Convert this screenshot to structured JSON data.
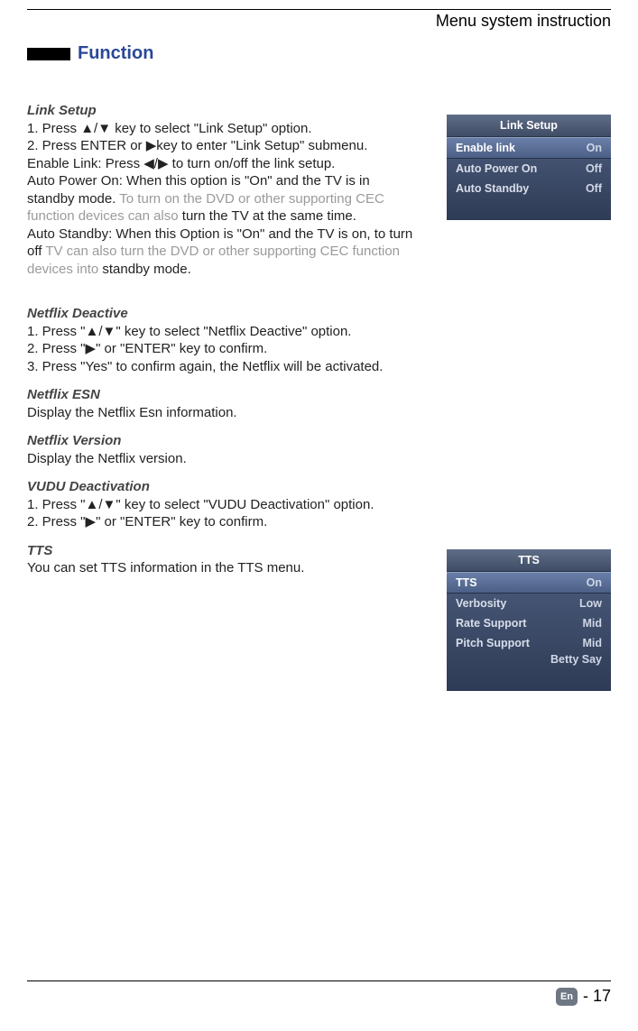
{
  "header": {
    "chapter": "Menu system instruction",
    "section": "Function"
  },
  "linkSetup": {
    "heading": "Link Setup",
    "l1a": "1. Press  ",
    "l1b": " key to select \"Link Setup\" option.",
    "l2a": "2. Press ENTER or ",
    "l2b": "key to enter \"Link Setup\" submenu.",
    "l3a": "Enable Link: Press  ",
    "l3b": "    to turn on/off the link setup.",
    "l4a": "Auto Power On: When this option is \"On\" and the TV is in standby mode. ",
    "l4_faded": "To turn on the DVD or other supporting CEC function devices can also ",
    "l4b": "turn the TV at the same time.",
    "l5a": "Auto Standby: When this Option is \"On\" and the TV is on, to turn off ",
    "l5_faded": "TV can also turn the DVD or other supporting CEC function devices into ",
    "l5b": "standby mode."
  },
  "netflixDeactive": {
    "heading": "Netflix Deactive",
    "l1a": "1. Press \"",
    "l1b": "\" key to select \"Netflix Deactive\" option.",
    "l2a": "2. Press \"",
    "l2b": "\" or \"ENTER\" key to confirm.",
    "l3": "3. Press \"Yes\" to confirm again, the Netflix will be activated."
  },
  "netflixEsn": {
    "heading": "Netflix ESN",
    "body": "Display the Netflix Esn information."
  },
  "netflixVersion": {
    "heading": "Netflix Version",
    "body": "Display the Netflix version."
  },
  "vudu": {
    "heading": "VUDU Deactivation",
    "l1a": "1. Press \"",
    "l1b": "\" key to select \"VUDU Deactivation\" option.",
    "l2a": "2. Press \"",
    "l2b": "\" or \"ENTER\" key to confirm."
  },
  "tts": {
    "heading": "TTS",
    "body": "You can set TTS information in the TTS menu."
  },
  "arrows": {
    "updown": "▲/▼",
    "right": "▶",
    "leftright": "◀/▶"
  },
  "osdLinkSetup": {
    "title": "Link Setup",
    "rows": [
      {
        "label": "Enable link",
        "value": "On",
        "highlight": true
      },
      {
        "label": "Auto Power On",
        "value": "Off",
        "highlight": false
      },
      {
        "label": "Auto Standby",
        "value": "Off",
        "highlight": false
      }
    ]
  },
  "osdTTS": {
    "title": "TTS",
    "rows": [
      {
        "label": "TTS",
        "value": "On",
        "highlight": true
      },
      {
        "label": "Verbosity",
        "value": "Low",
        "highlight": false
      },
      {
        "label": "Rate Support",
        "value": "Mid",
        "highlight": false
      },
      {
        "label": "Pitch Support",
        "value": "Mid",
        "highlight": false
      }
    ],
    "extra": "Betty Say"
  },
  "footer": {
    "lang": "En",
    "page": "- 17"
  }
}
